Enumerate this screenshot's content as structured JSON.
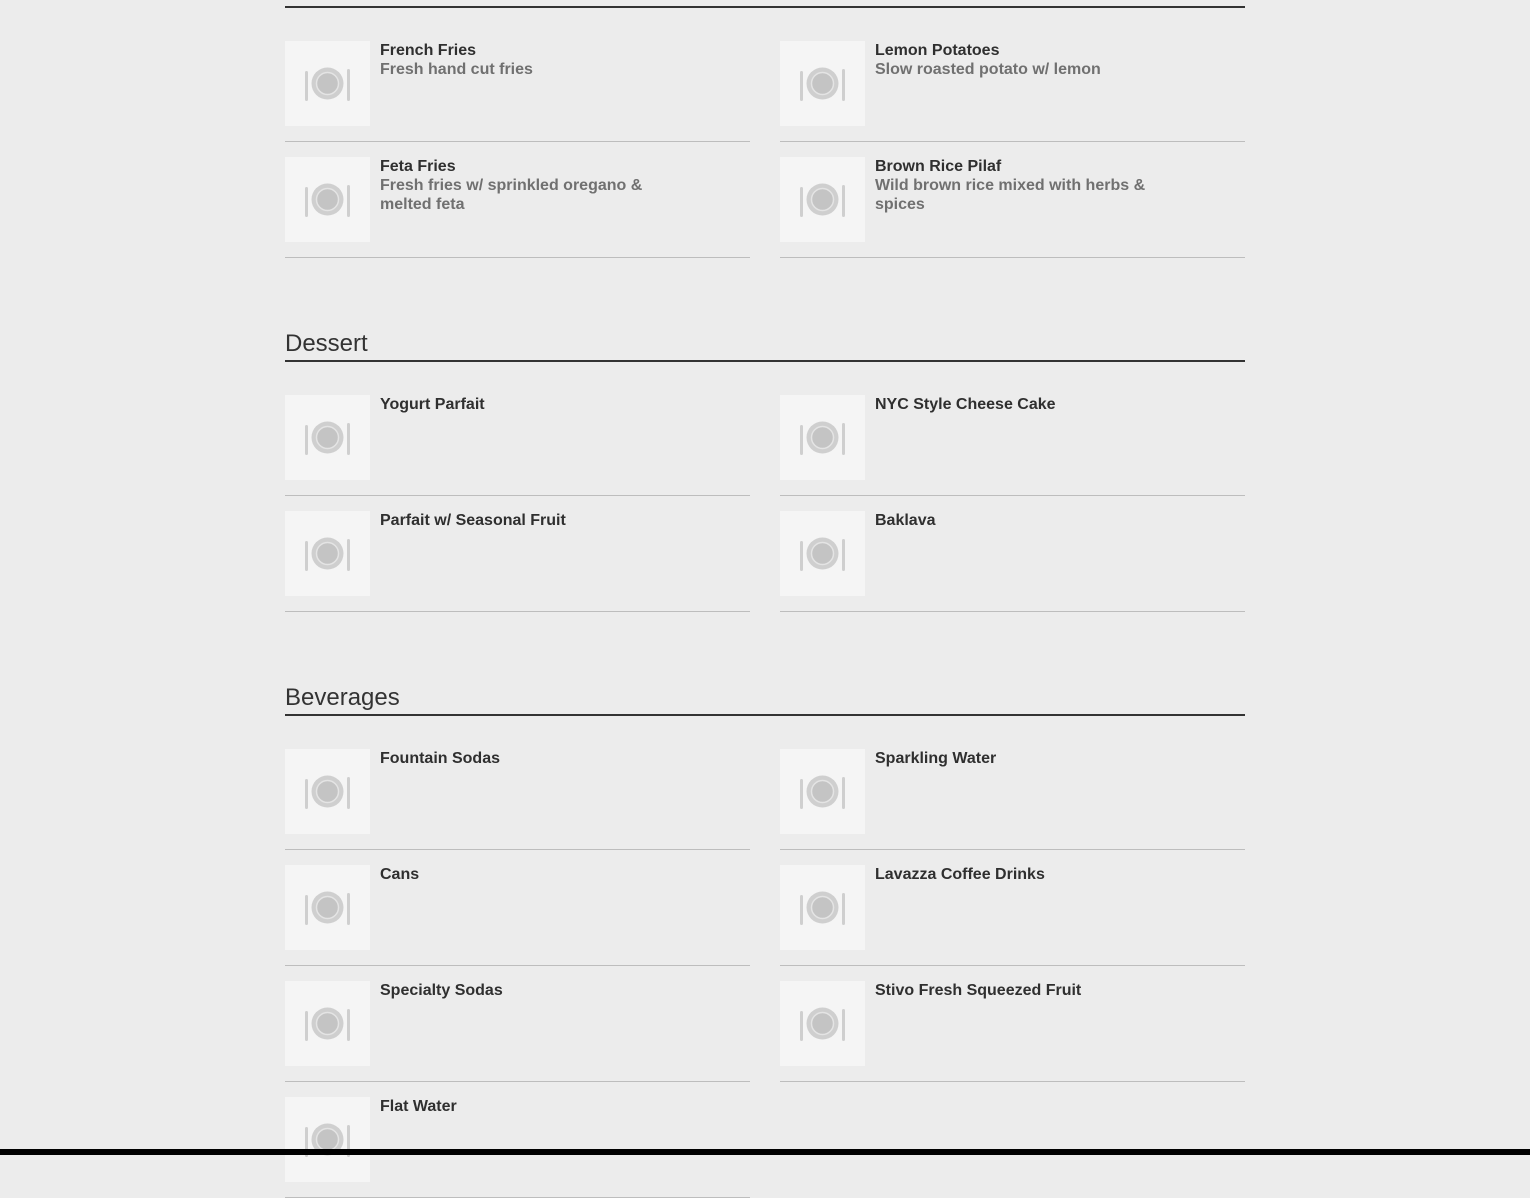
{
  "sections": {
    "sides": {
      "items": [
        {
          "name": "French Fries",
          "description": "Fresh hand cut fries"
        },
        {
          "name": "Lemon Potatoes",
          "description": "Slow roasted potato w/ lemon"
        },
        {
          "name": "Feta Fries",
          "description": "Fresh fries w/ sprinkled oregano & melted feta"
        },
        {
          "name": "Brown Rice Pilaf",
          "description": "Wild brown rice mixed with herbs & spices"
        }
      ]
    },
    "dessert": {
      "title": "Dessert",
      "items": [
        {
          "name": "Yogurt Parfait"
        },
        {
          "name": "NYC Style Cheese Cake"
        },
        {
          "name": "Parfait w/ Seasonal Fruit"
        },
        {
          "name": "Baklava"
        }
      ]
    },
    "beverages": {
      "title": "Beverages",
      "items": [
        {
          "name": "Fountain Sodas"
        },
        {
          "name": "Sparkling Water"
        },
        {
          "name": "Cans"
        },
        {
          "name": "Lavazza Coffee Drinks"
        },
        {
          "name": "Specialty Sodas"
        },
        {
          "name": "Stivo Fresh Squeezed Fruit"
        },
        {
          "name": "Flat Water"
        }
      ]
    }
  },
  "icons": {
    "item_placeholder": "plate-fork-knife-icon"
  },
  "colors": {
    "background": "#ececec",
    "heading_rule": "#333333",
    "item_rule": "#bdbdbd",
    "description_text": "#707070"
  }
}
